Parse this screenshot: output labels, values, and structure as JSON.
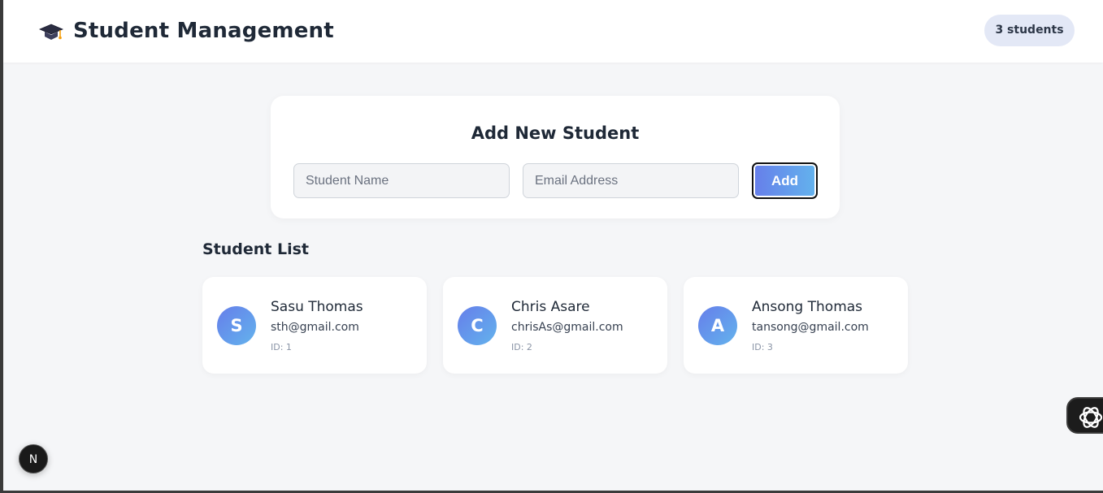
{
  "header": {
    "logo_icon": "graduation-cap-icon",
    "title": "Student Management",
    "count_badge": "3 students"
  },
  "form": {
    "title": "Add New Student",
    "name_placeholder": "Student Name",
    "email_placeholder": "Email Address",
    "add_label": "Add"
  },
  "list": {
    "title": "Student List",
    "students": [
      {
        "initial": "S",
        "name": "Sasu Thomas",
        "email": "sth@gmail.com",
        "id": "ID: 1"
      },
      {
        "initial": "C",
        "name": "Chris Asare",
        "email": "chrisAs@gmail.com",
        "id": "ID: 2"
      },
      {
        "initial": "A",
        "name": "Ansong Thomas",
        "email": "tansong@gmail.com",
        "id": "ID: 3"
      }
    ]
  },
  "overlays": {
    "next_badge": "N",
    "assistant_icon": "openai-icon"
  },
  "colors": {
    "accent_start": "#667eea",
    "accent_end": "#63b3ed",
    "page_bg": "#f5f6f8",
    "badge_bg": "#e3e8f6"
  }
}
